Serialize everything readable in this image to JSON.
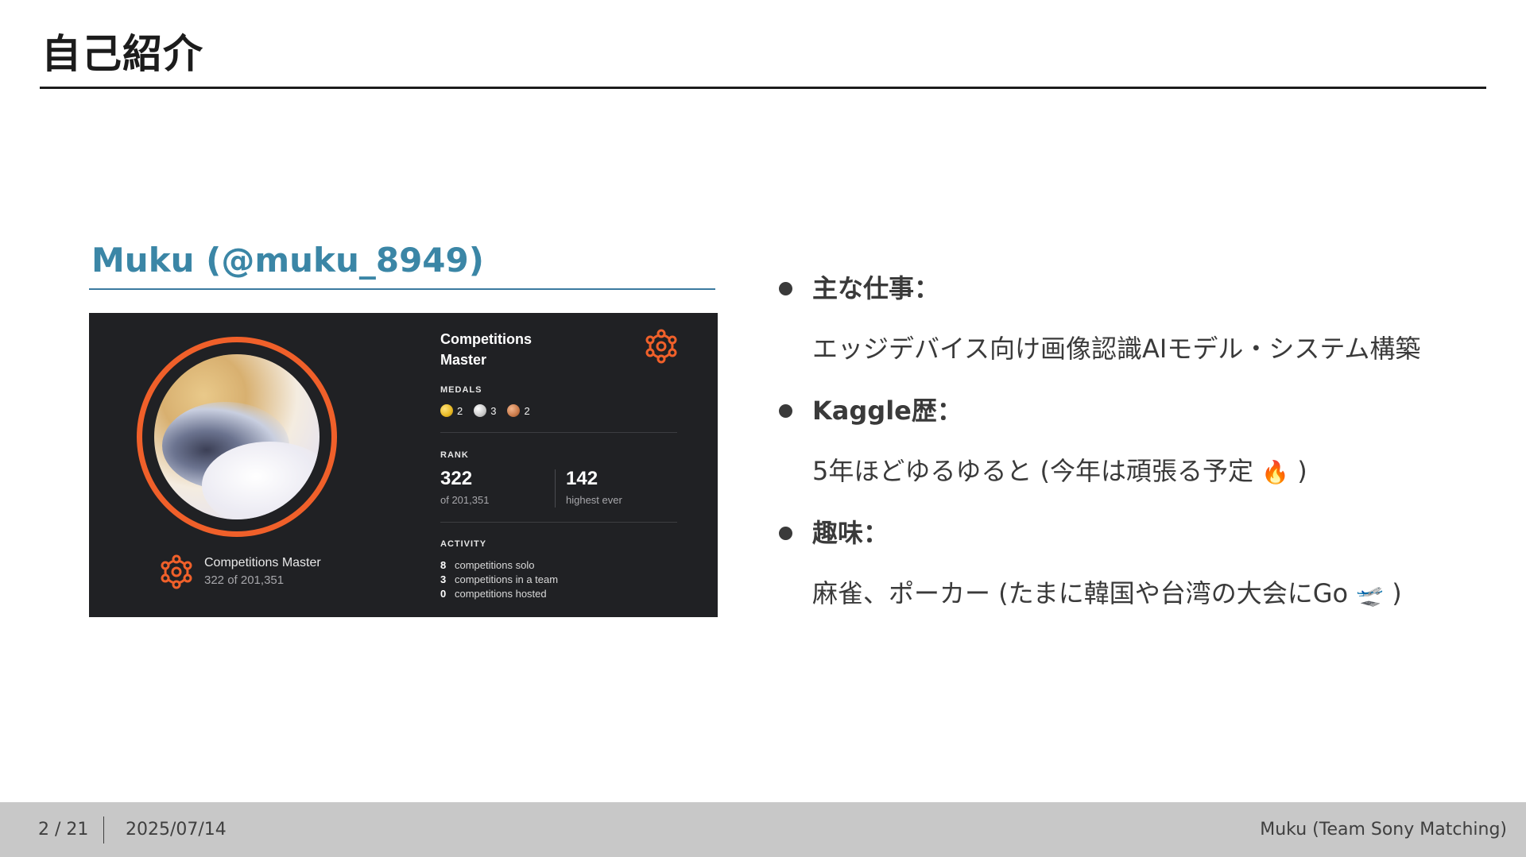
{
  "slide": {
    "title": "自己紹介"
  },
  "profile": {
    "name": "Muku (@muku_8949)",
    "card": {
      "title": "Competitions Master",
      "tier_label": "Competitions Master",
      "tier_sub": "322 of 201,351",
      "medals_label": "MEDALS",
      "medals": [
        {
          "kind": "gold",
          "count": "2",
          "color": "#e8b923"
        },
        {
          "kind": "silver",
          "count": "3",
          "color": "#c9c9c9"
        },
        {
          "kind": "bronze",
          "count": "2",
          "color": "#c97a4a"
        }
      ],
      "rank_label": "RANK",
      "rank": "322",
      "rank_of": "of 201,351",
      "highest": "142",
      "highest_label": "highest ever",
      "activity_label": "ACTIVITY",
      "activity": [
        {
          "count": "8",
          "label": "competitions solo"
        },
        {
          "count": "3",
          "label": "competitions in a team"
        },
        {
          "count": "0",
          "label": "competitions hosted"
        }
      ],
      "accent": "#f0602a"
    }
  },
  "bullets": [
    {
      "head": "主な仕事：",
      "body": "エッジデバイス向け画像認識AIモデル・システム構築"
    },
    {
      "head": "Kaggle歴：",
      "body_pre": "5年ほどゆるゆると (今年は頑張る予定",
      "emoji": "🔥",
      "body_post": ")"
    },
    {
      "head": "趣味：",
      "body_pre": "麻雀、ポーカー (たまに韓国や台湾の大会にGo",
      "emoji": "🛫",
      "body_post": ")"
    }
  ],
  "footer": {
    "page": "2 / 21",
    "date": "2025/07/14",
    "author": "Muku (Team Sony Matching)"
  }
}
